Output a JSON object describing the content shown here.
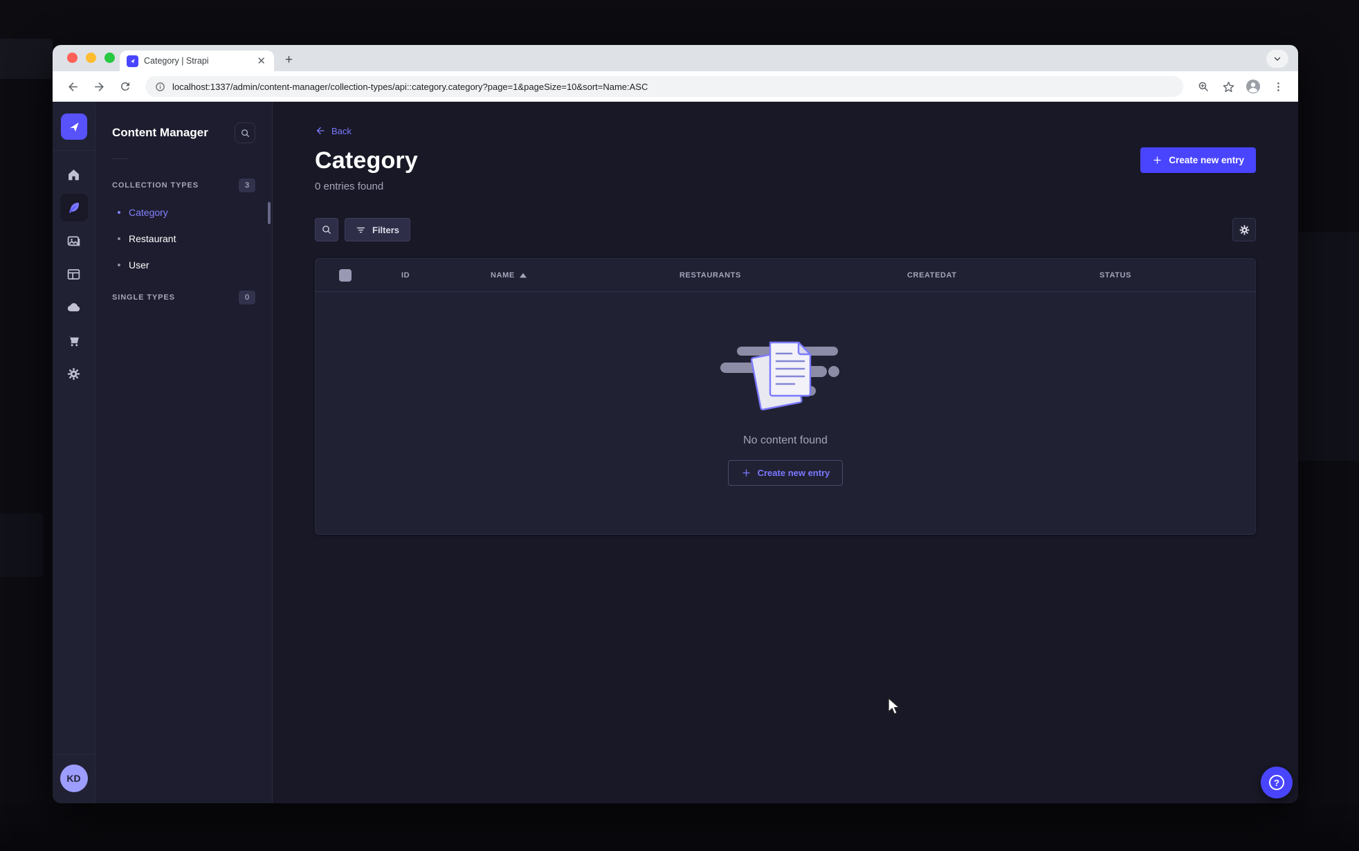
{
  "browser": {
    "tab_title": "Category | Strapi",
    "url": "localhost:1337/admin/content-manager/collection-types/api::category.category?page=1&pageSize=10&sort=Name:ASC"
  },
  "rail": {
    "avatar_initials": "KD"
  },
  "subnav": {
    "title": "Content Manager",
    "sections": [
      {
        "label": "COLLECTION TYPES",
        "count": "3",
        "items": [
          {
            "label": "Category",
            "active": true
          },
          {
            "label": "Restaurant",
            "active": false
          },
          {
            "label": "User",
            "active": false
          }
        ]
      },
      {
        "label": "SINGLE TYPES",
        "count": "0",
        "items": []
      }
    ]
  },
  "main": {
    "back_label": "Back",
    "title": "Category",
    "subtitle": "0 entries found",
    "create_button_label": "Create new entry",
    "filters_label": "Filters",
    "table": {
      "columns": [
        "ID",
        "NAME",
        "RESTAURANTS",
        "CREATEDAT",
        "STATUS"
      ],
      "sorted_column": "NAME",
      "sort_direction": "ASC",
      "rows": []
    },
    "empty_state": {
      "message": "No content found",
      "create_button_label": "Create new entry"
    }
  },
  "help": {
    "glyph": "?"
  },
  "colors": {
    "accent": "#4945ff",
    "link": "#7b79ff",
    "surface": "#212134",
    "background": "#181826"
  }
}
